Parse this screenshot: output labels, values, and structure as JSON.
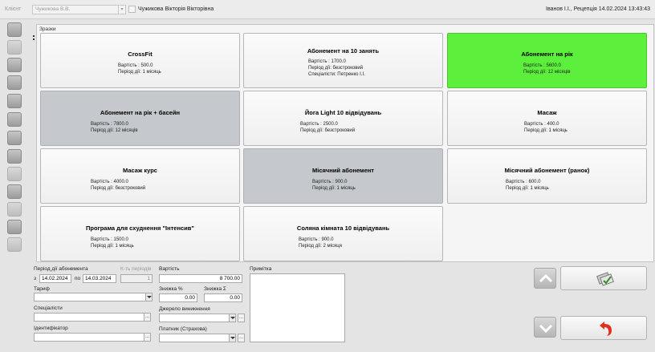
{
  "header": {
    "client_label": "Клієнт",
    "client_select_value": "Чужикова В.В.",
    "client_full_name": "Чужикова Вікторія Вікторівна",
    "user_info": "Іванов І.І., Рецепція   14.02.2024 13:43:43"
  },
  "sidebar": {
    "icons": [
      "user-icon",
      "folder-icon",
      "building-icon",
      "group-icon",
      "chart-icon",
      "trophy-icon",
      "calendar-icon",
      "calendar-icon",
      "calendar-icon",
      "list-icon",
      "settings-icon",
      "tag-icon",
      "help-icon"
    ]
  },
  "templates": {
    "title": "Зразки",
    "tiles": [
      {
        "name": "CrossFit",
        "lines": [
          "Вартість : 500.0",
          "Період дії: 1 місяць"
        ],
        "state": "normal"
      },
      {
        "name": "Абонемент на 10 занять",
        "lines": [
          "Вартість : 1700.0",
          "Період дії: безстроковий",
          "Спеціалісти: Петренко І.І."
        ],
        "state": "normal"
      },
      {
        "name": "Абонемент на рік",
        "lines": [
          "Вартість : 5600.0",
          "Період дії: 12 місяців"
        ],
        "state": "selected"
      },
      {
        "name": "Абонемент на рік + басейн",
        "lines": [
          "Вартість : 7800.0",
          "Період дії: 12 місяців"
        ],
        "state": "disabled"
      },
      {
        "name": "Йога Light 10 відвідувань",
        "lines": [
          "Вартість : 2500.0",
          "Період дії: безстроковий"
        ],
        "state": "normal"
      },
      {
        "name": "Масаж",
        "lines": [
          "Вартість : 400.0",
          "Період дії: 1 місяць"
        ],
        "state": "normal"
      },
      {
        "name": "Масаж курс",
        "lines": [
          "Вартість : 4000.0",
          "Період дії: безстроковий"
        ],
        "state": "normal"
      },
      {
        "name": "Місячний абонемент",
        "lines": [
          "Вартість : 900.0",
          "Період дії: 1 місяць"
        ],
        "state": "disabled"
      },
      {
        "name": "Місячний абонемент (ранок)",
        "lines": [
          "Вартість : 600.0",
          "Період дії: 1 місяць"
        ],
        "state": "normal"
      },
      {
        "name": "Програма для схуднення \"Інтенсив\"",
        "lines": [
          "Вартість : 1500.0",
          "Період дії: 1 місяць"
        ],
        "state": "normal"
      },
      {
        "name": "Соляна кімната 10 відвідувань",
        "lines": [
          "Вартість : 900.0",
          "Період дії: 2 місяця"
        ],
        "state": "normal"
      }
    ]
  },
  "form": {
    "period_label": "Період дії абонемента",
    "from_label": "з",
    "from_value": "14.02.2024",
    "to_label": "по",
    "to_value": "14.03.2024",
    "periods_label": "К-ть періодів",
    "periods_value": "1",
    "price_label": "Вартість",
    "price_value": "8 700.00",
    "tariff_label": "Тариф",
    "tariff_value": "",
    "discount_pct_label": "Знижка %",
    "discount_pct_value": "0.00",
    "discount_sum_label": "Знижка Σ",
    "discount_sum_value": "0.00",
    "specialists_label": "Спеціалісти",
    "specialists_value": "",
    "source_label": "Джерело виникнення",
    "source_value": "",
    "identifier_label": "Ідентифікатор",
    "identifier_value": "",
    "payer_label": "Платник (Страхова)",
    "payer_value": "",
    "note_label": "Примітка",
    "note_value": "",
    "ellipsis": "..."
  },
  "buttons": {
    "up": "chevron-up-icon",
    "down": "chevron-down-icon",
    "confirm": "tickets-check-icon",
    "back": "undo-arrow-icon"
  },
  "colors": {
    "selected_tile": "#5cf03c",
    "disabled_tile": "#c5c8cc",
    "back_arrow": "#e03020"
  }
}
